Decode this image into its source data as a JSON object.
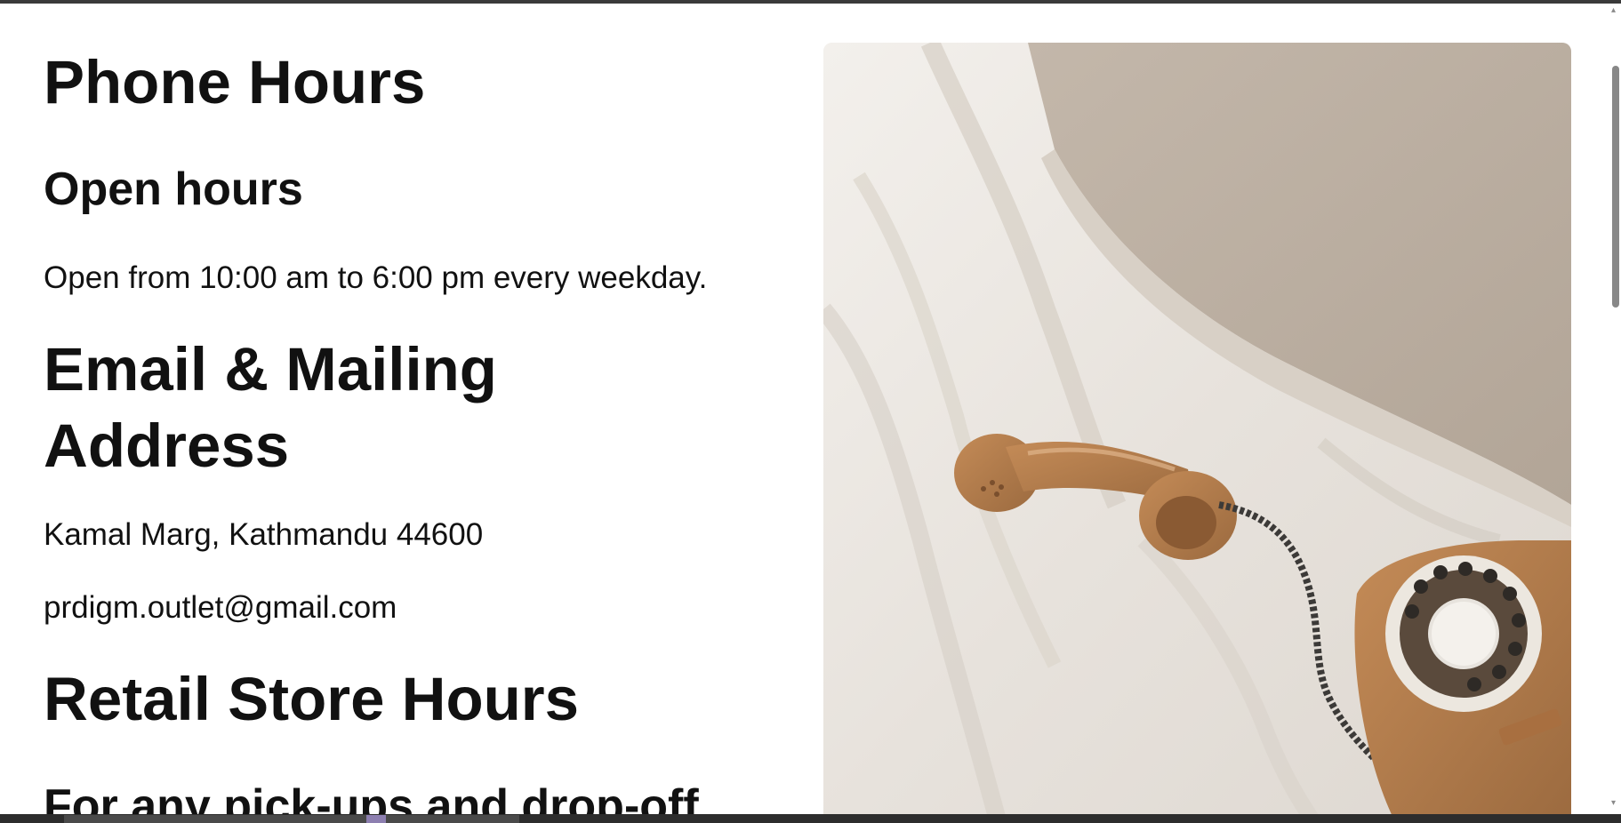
{
  "content": {
    "phone_heading": "Phone Hours",
    "open_hours_heading": "Open hours",
    "open_hours_text": "Open from 10:00 am to 6:00 pm every weekday.",
    "email_heading_line1": "Email & Mailing",
    "email_heading_line2": "Address",
    "address_text": "Kamal Marg, Kathmandu 44600",
    "email_text": "prdigm.outlet@gmail.com",
    "retail_heading": "Retail Store Hours",
    "pickup_heading": "For any pick-ups and drop-off"
  },
  "image": {
    "subject": "rotary-telephone-on-bed-photo"
  },
  "colors": {
    "text": "#111111",
    "background": "#ffffff",
    "phone_body": "#b07a4b",
    "sheet": "#ebe7e1",
    "pillow": "#c9bdb0"
  }
}
